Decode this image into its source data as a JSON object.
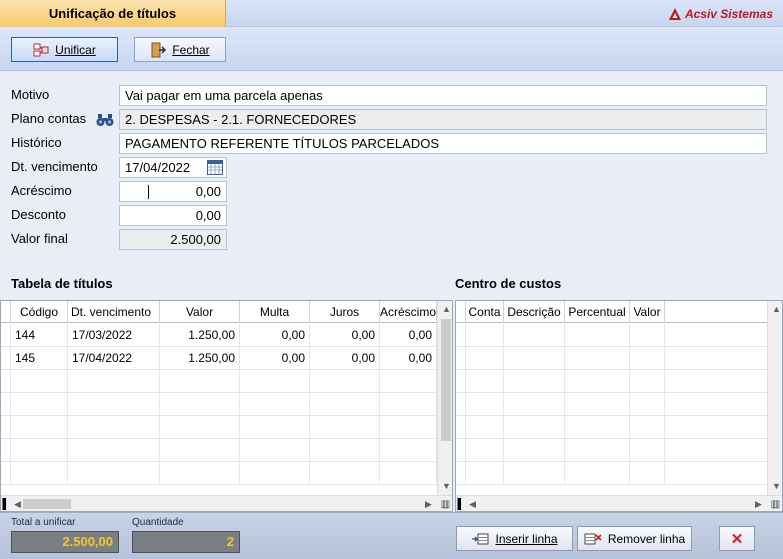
{
  "window": {
    "title": "Unificação de títulos",
    "brand": "Acsiv Sistemas"
  },
  "toolbar": {
    "unify_label": "Unificar",
    "close_label": "Fechar"
  },
  "form": {
    "motivo_label": "Motivo",
    "motivo_value": "Vai pagar em uma parcela apenas",
    "plano_label": "Plano contas",
    "plano_value": "2. DESPESAS - 2.1. FORNECEDORES",
    "historico_label": "Histórico",
    "historico_value": "PAGAMENTO REFERENTE TÍTULOS PARCELADOS",
    "vencimento_label": "Dt. vencimento",
    "vencimento_value": "17/04/2022",
    "acrescimo_label": "Acréscimo",
    "acrescimo_value": "0,00",
    "desconto_label": "Desconto",
    "desconto_value": "0,00",
    "valor_final_label": "Valor final",
    "valor_final_value": "2.500,00"
  },
  "titulos": {
    "title": "Tabela de títulos",
    "columns": [
      "Código",
      "Dt. vencimento",
      "Valor",
      "Multa",
      "Juros",
      "Acréscimo"
    ],
    "rows": [
      [
        "144",
        "17/03/2022",
        "1.250,00",
        "0,00",
        "0,00",
        "0,00"
      ],
      [
        "145",
        "17/04/2022",
        "1.250,00",
        "0,00",
        "0,00",
        "0,00"
      ]
    ]
  },
  "custos": {
    "title": "Centro de custos",
    "columns": [
      "Conta",
      "Descrição",
      "Percentual",
      "Valor"
    ]
  },
  "footer": {
    "total_label": "Total a unificar",
    "total_value": "2.500,00",
    "qtd_label": "Quantidade",
    "qtd_value": "2",
    "insert_label": "Inserir linha",
    "remove_label": "Remover linha"
  },
  "colors": {
    "accent_tab": "#f9c86a",
    "brand_red": "#c0171c",
    "footer_value": "#f5c531"
  }
}
